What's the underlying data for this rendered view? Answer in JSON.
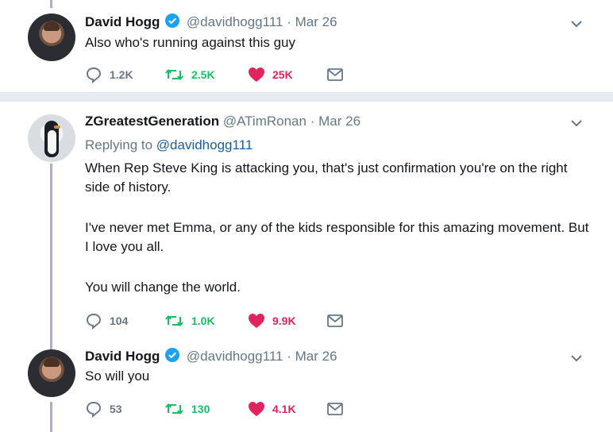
{
  "tweets": [
    {
      "name": "David Hogg",
      "verified": true,
      "handle": "@davidhogg111",
      "separator": "·",
      "date": "Mar 26",
      "text": "Also who's running against this guy",
      "reply_count": "1.2K",
      "retweet_count": "2.5K",
      "like_count": "25K"
    },
    {
      "name": "ZGreatestGeneration",
      "verified": false,
      "handle": "@ATimRonan",
      "separator": "·",
      "date": "Mar 26",
      "replying_prefix": "Replying to ",
      "replying_to": "@davidhogg111",
      "paragraphs": [
        "When Rep Steve King is attacking you, that's just confirmation you're on the right side of history.",
        "I've never met Emma, or any of the kids responsible for this amazing movement. But I love you all.",
        "You will change the world."
      ],
      "reply_count": "104",
      "retweet_count": "1.0K",
      "like_count": "9.9K"
    },
    {
      "name": "David Hogg",
      "verified": true,
      "handle": "@davidhogg111",
      "separator": "·",
      "date": "Mar 26",
      "text": "So will you",
      "reply_count": "53",
      "retweet_count": "130",
      "like_count": "4.1K"
    }
  ],
  "icons": {
    "reply": "reply-icon",
    "retweet": "retweet-icon",
    "like": "heart-icon",
    "message": "envelope-icon",
    "more": "chevron-down-icon",
    "verified": "verified-badge-icon"
  },
  "colors": {
    "verified": "#1da1f2",
    "retweet": "#17bf63",
    "like": "#e0245e",
    "muted": "#657786",
    "thread": "#b7a8cf"
  }
}
